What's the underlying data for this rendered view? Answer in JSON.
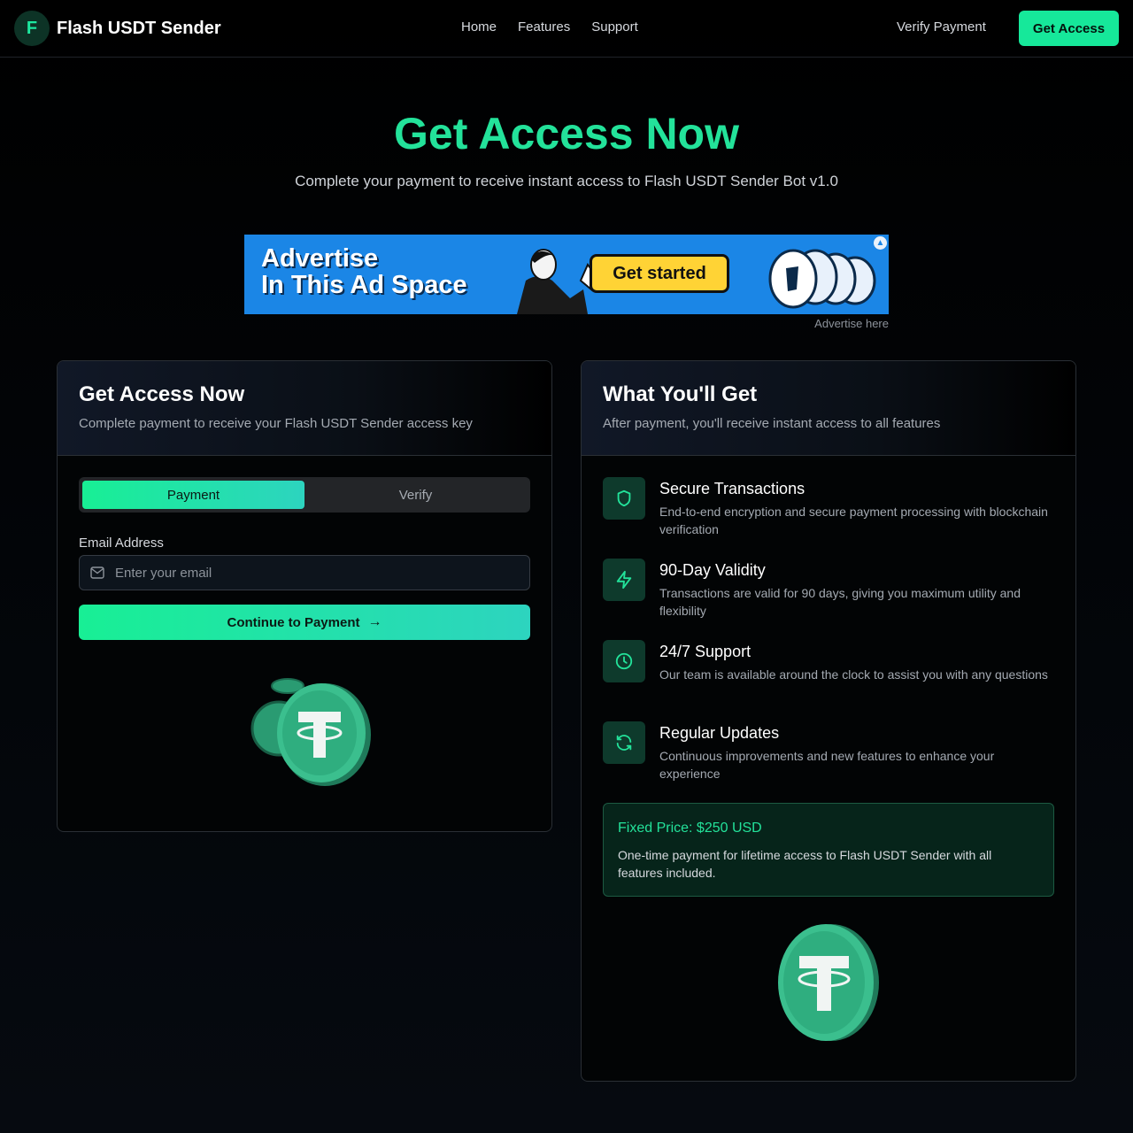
{
  "nav": {
    "logo_letter": "F",
    "brand": "Flash USDT Sender",
    "links": [
      "Home",
      "Features",
      "Support"
    ],
    "verify": "Verify Payment",
    "cta": "Get Access"
  },
  "hero": {
    "title": "Get Access Now",
    "subtitle": "Complete your payment to receive instant access to Flash USDT Sender Bot v1.0"
  },
  "ad": {
    "line1": "Advertise",
    "line2": "In This Ad Space",
    "button": "Get started",
    "caption": "Advertise here"
  },
  "payment_card": {
    "title": "Get Access Now",
    "description": "Complete payment to receive your Flash USDT Sender access key",
    "tabs": [
      "Payment",
      "Verify"
    ],
    "active_tab": "Payment",
    "email_label": "Email Address",
    "email_placeholder": "Enter your email",
    "email_value": "",
    "continue_label": "Continue to Payment"
  },
  "benefits_card": {
    "title": "What You'll Get",
    "description": "After payment, you'll receive instant access to all features",
    "features": [
      {
        "icon": "shield-icon",
        "title": "Secure Transactions",
        "desc": "End-to-end encryption and secure payment processing with blockchain verification"
      },
      {
        "icon": "lightning-icon",
        "title": "90-Day Validity",
        "desc": "Transactions are valid for 90 days, giving you maximum utility and flexibility"
      },
      {
        "icon": "clock-icon",
        "title": "24/7 Support",
        "desc": "Our team is available around the clock to assist you with any questions"
      },
      {
        "icon": "refresh-icon",
        "title": "Regular Updates",
        "desc": "Continuous improvements and new features to enhance your experience"
      }
    ],
    "price_title": "Fixed Price: $250 USD",
    "price_desc": "One-time payment for lifetime access to Flash USDT Sender with all features included."
  },
  "colors": {
    "accent": "#23e29a",
    "accent_button": "#16e89a",
    "background": "#000000",
    "ad_blue": "#1b86e6"
  }
}
